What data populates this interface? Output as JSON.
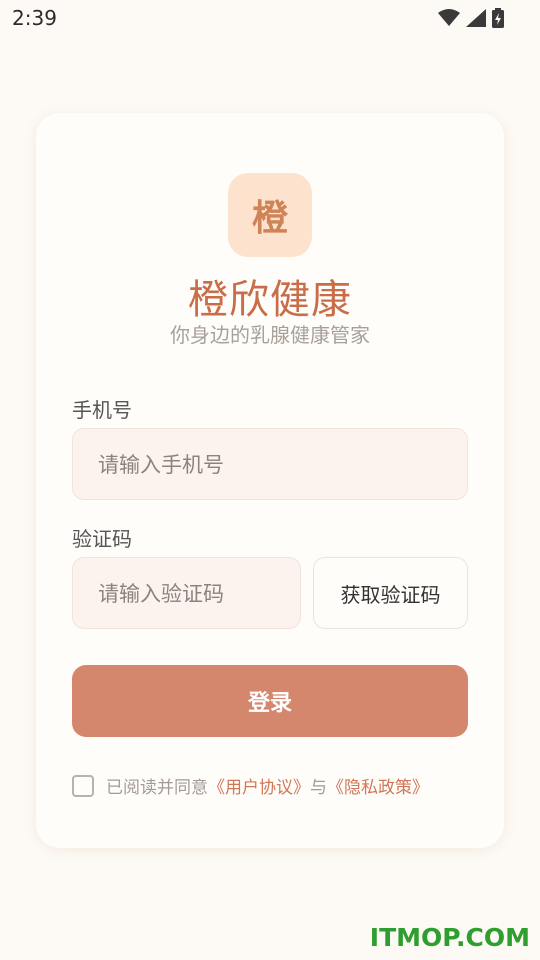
{
  "status_bar": {
    "time": "2:39",
    "icons": [
      "wifi-icon",
      "cellular-signal-icon",
      "battery-charging-icon"
    ]
  },
  "app": {
    "logo_char": "橙",
    "title": "橙欣健康",
    "subtitle": "你身边的乳腺健康管家"
  },
  "form": {
    "phone_label": "手机号",
    "phone_placeholder": "请输入手机号",
    "code_label": "验证码",
    "code_placeholder": "请输入验证码",
    "get_code_label": "获取验证码",
    "login_label": "登录"
  },
  "agreement": {
    "prefix": "已阅读并同意",
    "user_agreement": "《用户协议》",
    "conjunction": "与",
    "privacy_policy": "《隐私政策》",
    "checked": false
  },
  "watermark": "ITMOP.COM",
  "colors": {
    "background": "#fdf9f4",
    "accent": "#d4876c",
    "title": "#c86d48",
    "logo_bg": "#fde3ce",
    "input_bg": "#fdf3ee",
    "watermark": "#2e9e2e"
  }
}
